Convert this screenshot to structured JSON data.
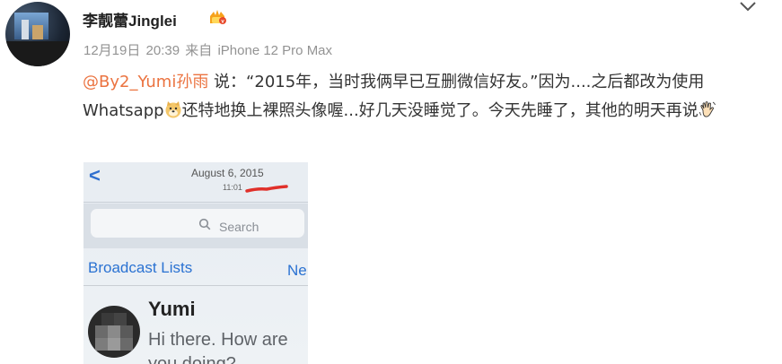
{
  "user": {
    "name": "李靓蕾Jinglei"
  },
  "post_meta": {
    "date": "12月19日",
    "time": "20:39",
    "source_prefix": "来自",
    "device": "iPhone 12 Pro Max"
  },
  "post": {
    "mention": "@By2_Yumi孙雨",
    "text_1": " 说：“2015年，当时我俩早已互删微信好友。”因为....之后都改为使用 Whatsapp",
    "text_2": "还特地换上裸照头像喔...好几天没睡觉了。今天先睡了，其他的明天再说",
    "emoji_1": "doge-emoji",
    "emoji_2": "wave-hand-emoji"
  },
  "photo": {
    "date": "August 6, 2015",
    "time": "11:01",
    "search_placeholder": "Search",
    "broadcast_label": "Broadcast Lists",
    "new_label": "Ne",
    "contact_name": "Yumi",
    "message_preview": "Hi there. How are you doing?"
  },
  "colors": {
    "mention": "#eb7340",
    "ios_blue": "#2a72d2",
    "meta_gray": "#939393",
    "redline": "#e0302a"
  },
  "icons": {
    "verified_badge": "gold-v-badge-icon",
    "more": "chevron-down-icon",
    "back": "chevron-left-icon",
    "search": "search-icon"
  }
}
